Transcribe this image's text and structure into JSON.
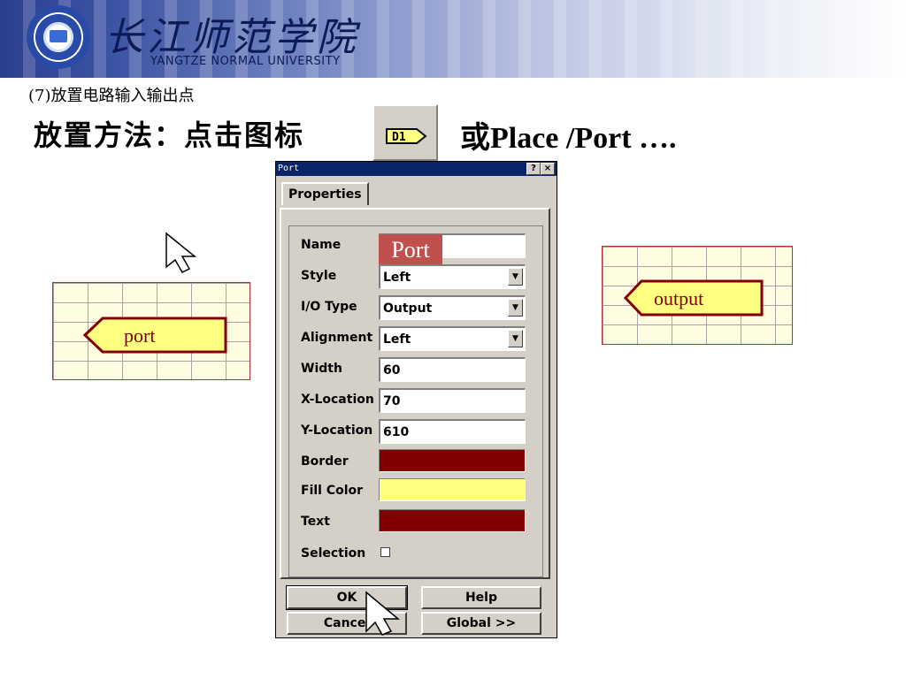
{
  "banner": {
    "school_name_cn": "长江师范学院",
    "school_name_en": "YANGTZE NORMAL UNIVERSITY"
  },
  "heading": {
    "subtitle": "(7)放置电路输入输出点",
    "method_label": "放置方法：点击图标",
    "method_alt": "或Place /Port ….",
    "toolbar_icon_label": "D1"
  },
  "dialog": {
    "title": "Port",
    "help_button": "?",
    "close_button": "×",
    "tab": "Properties",
    "fields": [
      {
        "label": "Name",
        "value": ""
      },
      {
        "label": "Style",
        "value": "Left"
      },
      {
        "label": "I/O Type",
        "value": "Output"
      },
      {
        "label": "Alignment",
        "value": "Left"
      },
      {
        "label": "Width",
        "value": "60"
      },
      {
        "label": "X-Location",
        "value": "70"
      },
      {
        "label": "Y-Location",
        "value": "610"
      }
    ],
    "colors": [
      {
        "label": "Border",
        "color": "#800000"
      },
      {
        "label": "Fill Color",
        "color": "#ffff80"
      },
      {
        "label": "Text",
        "color": "#800000"
      }
    ],
    "selection_label": "Selection",
    "selection_checked": false,
    "buttons": {
      "ok": "OK",
      "cancel": "Cancel",
      "help": "Help",
      "global": "Global >>"
    },
    "name_badge": "Port"
  },
  "examples": {
    "left_port": "port",
    "right_port": "output"
  },
  "colors": {
    "port_border": "#800000",
    "port_fill": "#ffff80",
    "title_bar": "#0a246a",
    "badge": "#c0504d"
  }
}
